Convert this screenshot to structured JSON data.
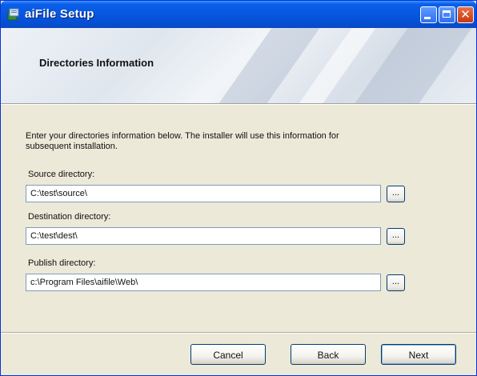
{
  "window": {
    "title": "aiFile Setup"
  },
  "titlebar_controls": {
    "minimize_icon": "minimize-icon",
    "maximize_icon": "maximize-icon",
    "close_icon": "close-icon",
    "close_glyph": "✕"
  },
  "banner": {
    "title": "Directories Information"
  },
  "intro": {
    "text": "Enter your directories information below. The installer will use this information for subsequent installation."
  },
  "fields": [
    {
      "label": "Source directory:",
      "value": "C:\\test\\source\\",
      "browse_label": "..."
    },
    {
      "label": "Destination directory:",
      "value": "C:\\test\\dest\\",
      "browse_label": "..."
    },
    {
      "label": "Publish directory:",
      "value": "c:\\Program Files\\aifile\\Web\\",
      "browse_label": "..."
    }
  ],
  "footer": {
    "cancel_label": "Cancel",
    "back_label": "Back",
    "next_label": "Next"
  },
  "colors": {
    "titlebar": "#0858e0",
    "dialog_bg": "#ece9d8",
    "input_border": "#7f9db9"
  }
}
